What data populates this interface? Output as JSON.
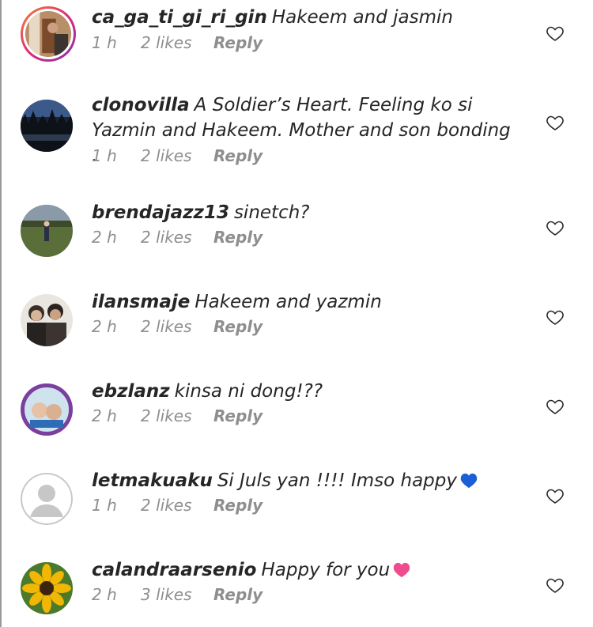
{
  "comments": [
    {
      "username": "ca_ga_ti_gi_ri_gin",
      "text": "Hakeem and jasmin",
      "time": "1 h",
      "likes": "2 likes",
      "reply": "Reply",
      "avatar": "story-ring-photo",
      "emoji": ""
    },
    {
      "username": "clonovilla",
      "text": "A Soldier’s Heart. Feeling ko si  Yazmin and Hakeem. Mother  and son bonding .",
      "time": "1 h",
      "likes": "2 likes",
      "reply": "Reply",
      "avatar": "night-forest-photo",
      "emoji": ""
    },
    {
      "username": "brendajazz13",
      "text": "sinetch?",
      "time": "2 h",
      "likes": "2 likes",
      "reply": "Reply",
      "avatar": "field-photo",
      "emoji": ""
    },
    {
      "username": "ilansmaje",
      "text": "Hakeem and yazmin",
      "time": "2 h",
      "likes": "2 likes",
      "reply": "Reply",
      "avatar": "couple-photo",
      "emoji": ""
    },
    {
      "username": "ebzlanz",
      "text": "kinsa ni dong!??",
      "time": "2 h",
      "likes": "2 likes",
      "reply": "Reply",
      "avatar": "sticker-photo",
      "emoji": ""
    },
    {
      "username": "letmakuaku",
      "text": "Si Juls yan !!!! Imso happy",
      "time": "1 h",
      "likes": "2 likes",
      "reply": "Reply",
      "avatar": "default-avatar",
      "emoji": "blue-heart"
    },
    {
      "username": "calandraarsenio",
      "text": "Happy for you",
      "time": "2 h",
      "likes": "3 likes",
      "reply": "Reply",
      "avatar": "sunflower-photo",
      "emoji": "pink-heart"
    }
  ],
  "colors": {
    "text": "#262626",
    "meta": "#8e8e8e",
    "blue_heart": "#1a5fd6",
    "pink_heart": "#ee4c8c"
  },
  "icons": {
    "like": "heart-outline-icon"
  }
}
